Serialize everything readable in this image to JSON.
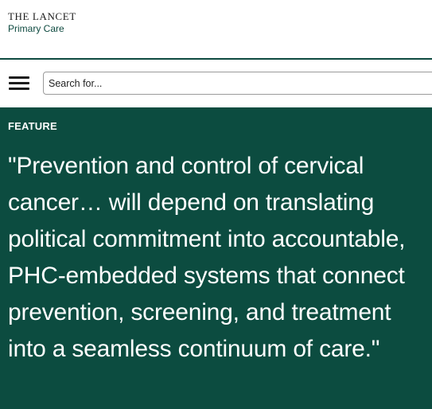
{
  "header": {
    "logo_title": "THE LANCET",
    "logo_subtitle": "Primary Care"
  },
  "toolbar": {
    "menu_icon": "hamburger-menu-icon",
    "search_placeholder": "Search for..."
  },
  "feature": {
    "label": "FEATURE",
    "quote": "\"Prevention and control of cervical cancer… will depend on translating political commitment into accountable, PHC-embedded systems that connect prevention, screening, and treatment into a seamless continuum of care.\"",
    "background_color": "#0c4c40"
  }
}
